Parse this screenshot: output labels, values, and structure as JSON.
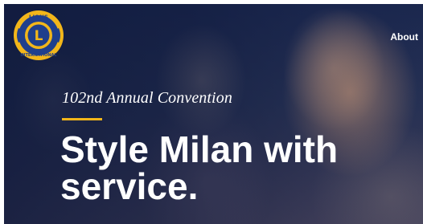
{
  "header": {
    "logo": {
      "icon": "lions-international-emblem",
      "top_text": "LIONS",
      "letter": "L",
      "bottom_text": "INTERNATIONAL",
      "colors": {
        "gold": "#f2b61a",
        "blue": "#1f3f8c"
      }
    },
    "nav": {
      "about_label": "About"
    }
  },
  "hero": {
    "subtitle": "102nd Annual Convention",
    "headline_line1": "Style Milan with",
    "headline_line2": "service.",
    "accent_color": "#f2b61a"
  }
}
